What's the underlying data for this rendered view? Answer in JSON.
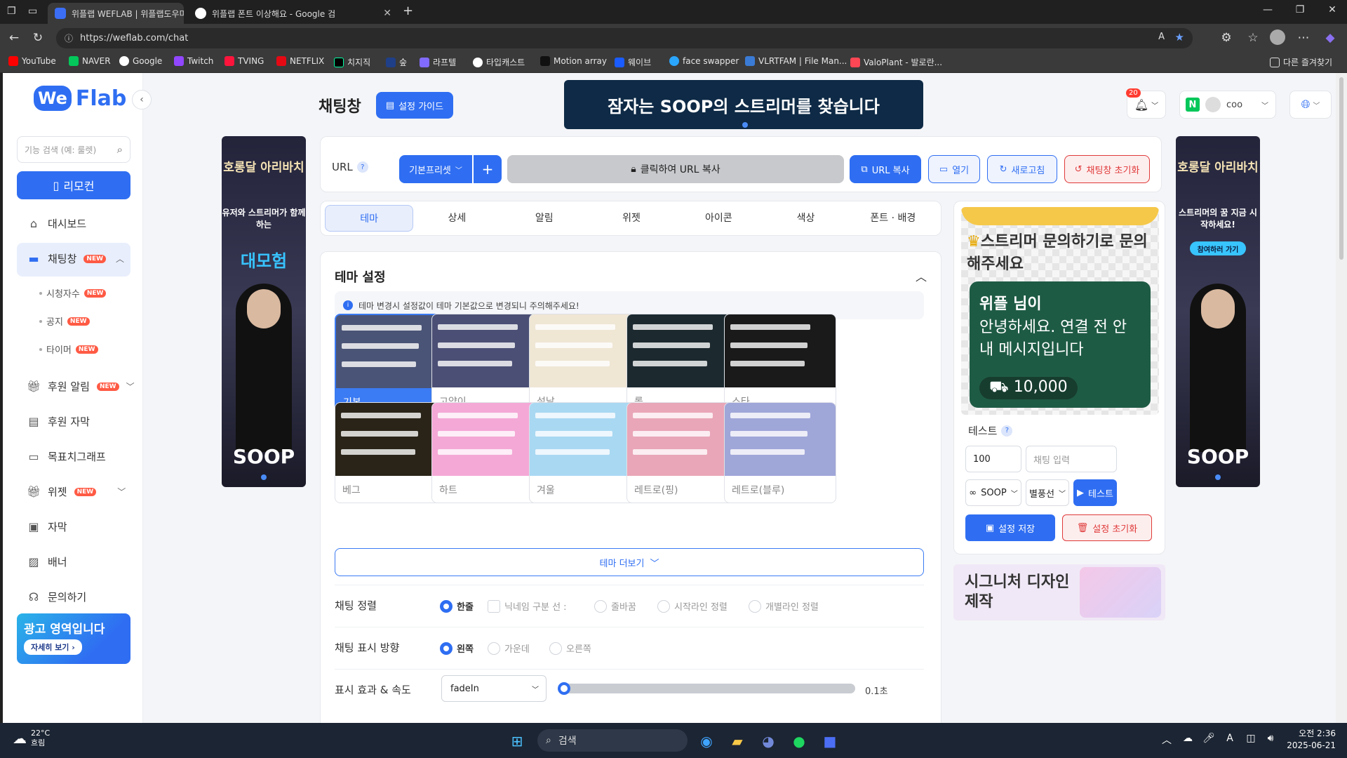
{
  "browser": {
    "tabs": [
      {
        "title": "위플랩 WEFLAB | 위플랩도우미",
        "active": true
      },
      {
        "title": "위플랩 폰트 이상해요 - Google 검",
        "active": false
      }
    ],
    "url": "https://weflab.com/chat",
    "bookmarks": [
      "YouTube",
      "NAVER",
      "Google",
      "Twitch",
      "TVING",
      "NETFLIX",
      "치지직",
      "숲",
      "라프텔",
      "타입캐스트",
      "Motion array",
      "웨이브",
      "face swapper",
      "VLRTFAM | File Man...",
      "ValoPlant - 발로란..."
    ],
    "other_bookmarks": "다른 즐겨찾기"
  },
  "sidebar": {
    "logo": "Flab",
    "logo_we": "We",
    "search_placeholder": "기능 검색 (예: 룰렛)",
    "remote_label": "리모컨",
    "items": [
      {
        "label": "대시보드",
        "new": false
      },
      {
        "label": "채팅창",
        "new": true
      },
      {
        "label": "후원 알림",
        "new": true
      },
      {
        "label": "후원 자막",
        "new": false
      },
      {
        "label": "목표치그래프",
        "new": false
      },
      {
        "label": "위젯",
        "new": true
      },
      {
        "label": "자막",
        "new": false
      },
      {
        "label": "배너",
        "new": false
      },
      {
        "label": "문의하기",
        "new": false
      }
    ],
    "subitems": [
      "시청자수",
      "공지",
      "타이머"
    ],
    "new_badge": "NEW",
    "ad_title": "광고 영역입니다",
    "ad_button": "자세히 보기"
  },
  "header": {
    "title": "채팅창",
    "guide_button": "설정 가이드",
    "banner_text": "잠자는 SOOP의 스트리머를 찾습니다",
    "notif_count": "20",
    "user_name": "coo"
  },
  "side_ads": {
    "left": {
      "brand": "호롱달 아리바치",
      "line": "유저와 스트리머가 함께하는",
      "headline": "대모험",
      "logo": "SOOP"
    },
    "right": {
      "brand": "호롱달 아리바치",
      "line": "스트리머의 꿈 지금 시작하세요!",
      "button": "참여하러 가기",
      "logo": "SOOP"
    }
  },
  "url_section": {
    "label": "URL",
    "preset": "기본프리셋",
    "copy_hint": "클릭하여 URL 복사",
    "copy_button": "URL 복사",
    "open_button": "열기",
    "refresh_button": "새로고침",
    "reset_button": "채팅창 초기화"
  },
  "tabs": [
    "테마",
    "상세",
    "알림",
    "위젯",
    "아이콘",
    "색상",
    "폰트 · 배경"
  ],
  "theme": {
    "title": "테마 설정",
    "notice": "테마 변경시 설정값이 테마 기본값으로 변경되니 주의해주세요!",
    "themes": [
      {
        "name": "기본",
        "color": "#4a5476",
        "selected": true
      },
      {
        "name": "고양이",
        "color": "#4b4f75",
        "selected": false
      },
      {
        "name": "설날",
        "color": "#efe6d4",
        "selected": false
      },
      {
        "name": "롤",
        "color": "#1c2a30",
        "selected": false
      },
      {
        "name": "스타",
        "color": "#1a1a1a",
        "selected": false
      },
      {
        "name": "베그",
        "color": "#2a2418",
        "selected": false
      },
      {
        "name": "하트",
        "color": "#f4a8d6",
        "selected": false
      },
      {
        "name": "겨울",
        "color": "#a9d8f2",
        "selected": false
      },
      {
        "name": "레트로(핑)",
        "color": "#e9a6b8",
        "selected": false
      },
      {
        "name": "레트로(블루)",
        "color": "#9fa6d8",
        "selected": false
      }
    ],
    "more_button": "테마 더보기",
    "align_label": "채팅 정렬",
    "align_options": [
      "한줄",
      "닉네임 구분 선 :",
      "줄바꿈",
      "시작라인 정렬",
      "개별라인 정렬"
    ],
    "direction_label": "채팅 표시 방향",
    "direction_options": [
      "왼쪽",
      "가운데",
      "오른쪽"
    ],
    "effect_label": "표시 효과 & 속도",
    "effect_value": "fadeIn",
    "speed_value": "0.1초"
  },
  "preview": {
    "title": "스트리머 문의하기로 문의해주세요",
    "name": "위플 님이",
    "message": "안녕하세요. 연결 전 안내 메시지입니다",
    "amount": "10,000",
    "test_label": "테스트",
    "amount_input": "100",
    "chat_placeholder": "채팅 입력",
    "platform": "SOOP",
    "type": "별풍선",
    "test_button": "테스트",
    "save_button": "설정 저장",
    "reset_button": "설정 초기화",
    "ad_text": "시그니처 디자인 제작"
  },
  "taskbar": {
    "weather_temp": "22°C",
    "weather_desc": "흐림",
    "search": "검색",
    "time": "오전 2:36",
    "date": "2025-06-21"
  }
}
